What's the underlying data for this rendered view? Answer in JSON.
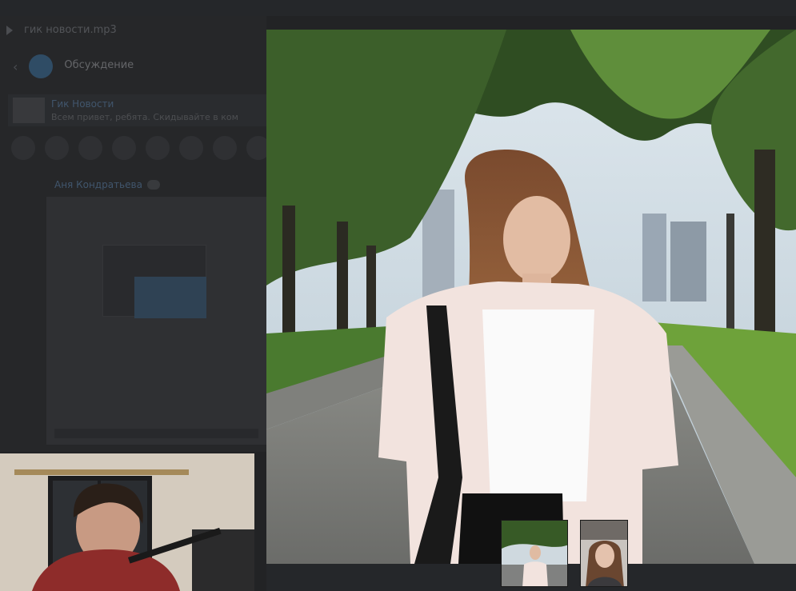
{
  "now_playing": {
    "title": "гик новости.mp3"
  },
  "thread": {
    "title": "Обсуждение",
    "subtitle": ""
  },
  "pinned": {
    "title": "Гик Новости",
    "text": "Всем привет, ребята. Скидывайте в ком"
  },
  "message": {
    "author": "Аня Кондратьева"
  },
  "icons": {
    "play": "play-icon",
    "back": "back-arrow-icon"
  },
  "colors": {
    "background": "#1e1f21",
    "accent_link": "#5a7fa6"
  }
}
